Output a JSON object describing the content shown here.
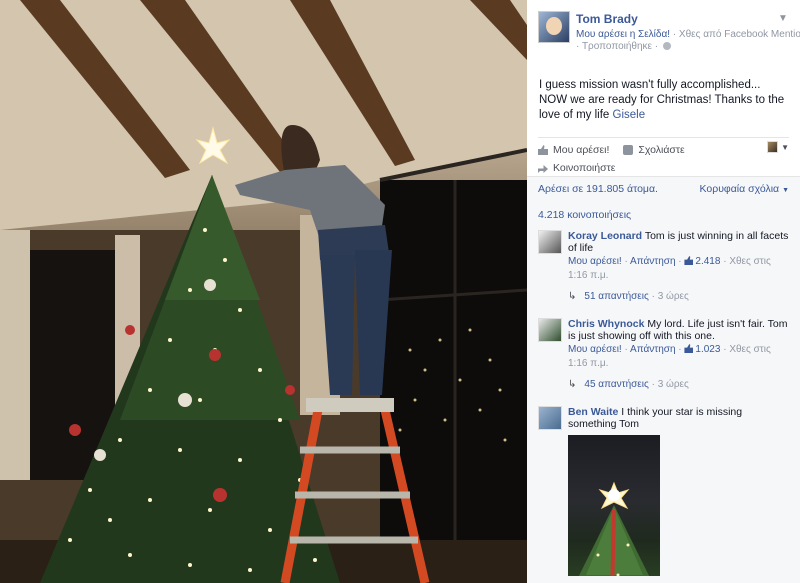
{
  "page": {
    "name": "Tom Brady",
    "liked_page": "Μου αρέσει η Σελίδα!",
    "time": "Χθες από Facebook Mentions",
    "edited": "Τροποποιήθηκε"
  },
  "post": {
    "text": "I guess mission wasn't fully accomplished... NOW we are ready for Christmas! Thanks to the love of my life",
    "tag": "Gisele"
  },
  "actions": {
    "like": "Μου αρέσει!",
    "comment": "Σχολιάστε",
    "share": "Κοινοποιήστε"
  },
  "stats": {
    "likes": "Αρέσει σε 191.805 άτομα.",
    "top_comments": "Κορυφαία σχόλια",
    "shares": "4.218 κοινοποιήσεις"
  },
  "comments": [
    {
      "name": "Koray Leonard",
      "text": "Tom is just winning in all facets of life",
      "like": "Μου αρέσει!",
      "reply": "Απάντηση",
      "like_count": "2.418",
      "time": "Χθες στις 1:16 π.μ.",
      "replies": "51 απαντήσεις",
      "replies_ago": "3 ώρες"
    },
    {
      "name": "Chris Whynock",
      "text": "My lord. Life just isn't fair. Tom is just showing off with this one.",
      "like": "Μου αρέσει!",
      "reply": "Απάντηση",
      "like_count": "1.023",
      "time": "Χθες στις 1:16 π.μ.",
      "replies": "45 απαντήσεις",
      "replies_ago": "3 ώρες"
    },
    {
      "name": "Ben Waite",
      "text": "I think your star is missing something Tom"
    }
  ],
  "colors": {
    "link": "#3b5998",
    "muted": "#9197a3",
    "panel_bg": "#f6f7f9"
  },
  "icons": [
    "like-icon",
    "comment-icon",
    "share-icon",
    "chevron-down-icon",
    "globe-icon",
    "reply-arrow-icon"
  ]
}
